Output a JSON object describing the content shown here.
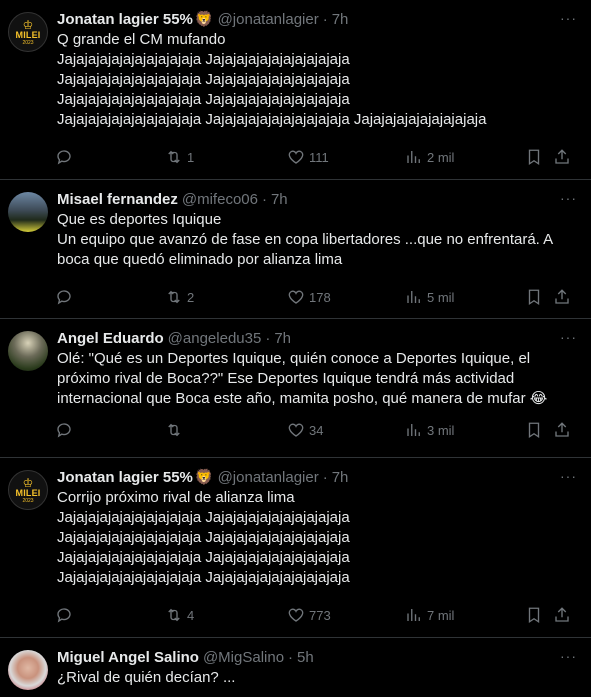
{
  "tweets": [
    {
      "name": "Jonatan lagier 55%",
      "badge": "🦁",
      "handle": "@jonatanlagier",
      "time": "7h",
      "text": "Q grande el CM mufando\nJajajajajajajajajajajaja Jajajajajajajajajajajaja\nJajajajajajajajajajajaja Jajajajajajajajajajajaja\nJajajajajajajajajajajaja Jajajajajajajajajajajaja\nJajajajajajajajajajajaja Jajajajajajajajajajajaja Jajajajajajajajajajaja",
      "avatar": "milei-icon",
      "replies": "",
      "retweets": "1",
      "likes": "111",
      "views": "2 mil"
    },
    {
      "name": "Misael fernandez",
      "badge": "",
      "handle": "@mifeco06",
      "time": "7h",
      "text": "Que es deportes Iquique\nUn equipo que avanzó de fase en copa libertadores ...que no enfrentará. A boca que quedó eliminado por alianza lima",
      "avatar": "group-photo",
      "replies": "",
      "retweets": "2",
      "likes": "178",
      "views": "5 mil"
    },
    {
      "name": "Angel Eduardo",
      "badge": "",
      "handle": "@angeledu35",
      "time": "7h",
      "text": "Olé: \"Qué es un Deportes Iquique, quién conoce a Deportes Iquique, el próximo rival de Boca??\" Ese Deportes Iquique tendrá más actividad internacional que Boca este año, mamita posho, qué manera de mufar 😂",
      "avatar": "stadium-photo",
      "replies": "",
      "retweets": "",
      "likes": "34",
      "views": "3 mil"
    },
    {
      "name": "Jonatan lagier 55%",
      "badge": "🦁",
      "handle": "@jonatanlagier",
      "time": "7h",
      "text": "Corrijo próximo rival de alianza lima\nJajajajajajajajajajajaja Jajajajajajajajajajajaja\nJajajajajajajajajajajaja Jajajajajajajajajajajaja\nJajajajajajajajajajajaja Jajajajajajajajajajajaja\nJajajajajajajajajajajaja Jajajajajajajajajajajaja",
      "avatar": "milei-icon",
      "replies": "",
      "retweets": "4",
      "likes": "773",
      "views": "7 mil"
    },
    {
      "name": "Miguel Angel Salino",
      "badge": "",
      "handle": "@MigSalino",
      "time": "5h",
      "text": "¿Rival de quién decían? ...",
      "avatar": "face-photo",
      "replies": "",
      "retweets": "",
      "likes": "",
      "views": ""
    }
  ],
  "milei_logo": {
    "text": "MILEI",
    "year": "2023"
  },
  "separator": "·",
  "more_icon": "···",
  "colors": {
    "background": "#000000",
    "text": "#e7e9ea",
    "muted": "#71767b",
    "border": "#2f3336"
  }
}
